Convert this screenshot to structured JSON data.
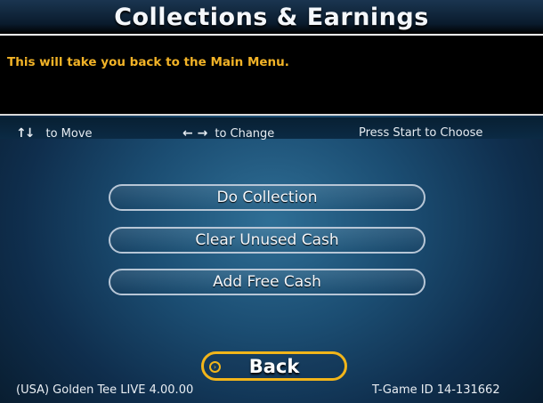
{
  "title": "Collections & Earnings",
  "message": "This will take you back to the Main Menu.",
  "hints": {
    "move_arrows": "↑↓",
    "move_label": "to Move",
    "change_arrows": "← →",
    "change_label": "to Change",
    "choose_label": "Press Start to Choose"
  },
  "menu": [
    {
      "label": "Do Collection"
    },
    {
      "label": "Clear Unused Cash"
    },
    {
      "label": "Add Free Cash"
    }
  ],
  "back": {
    "label": "Back",
    "icon": "›"
  },
  "footer": {
    "version": "(USA) Golden Tee LIVE 4.00.00",
    "game_id": "T-Game ID 14-131662"
  },
  "colors": {
    "accent_gold": "#f2b51a",
    "message_text": "#f2b327",
    "button_border": "#b7c6d6"
  }
}
